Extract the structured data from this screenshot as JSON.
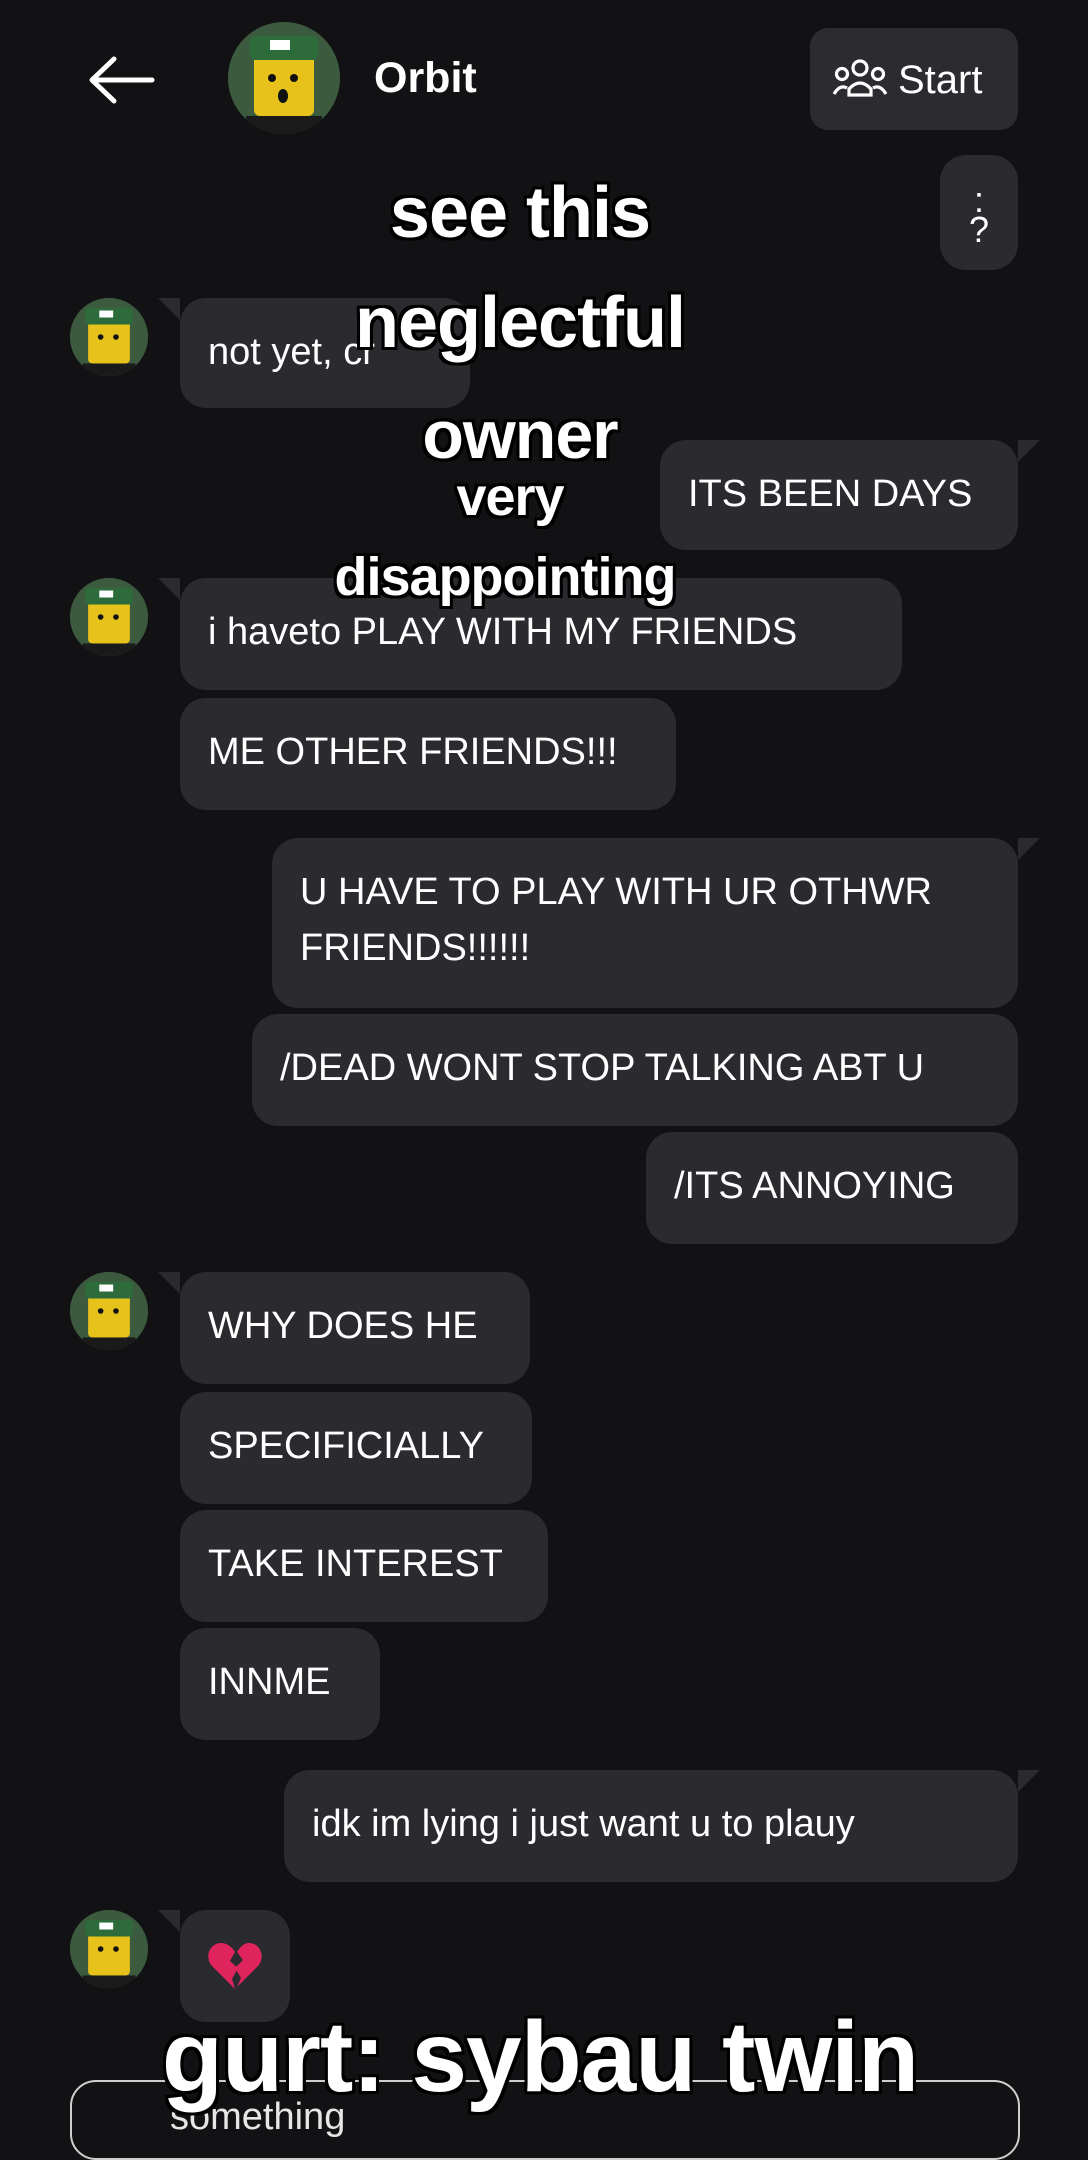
{
  "header": {
    "contact_name": "Orbit",
    "start_label": "Start"
  },
  "messages": [
    {
      "dir": "out",
      "text": ":\n?"
    },
    {
      "dir": "in",
      "text": "not yet, cr"
    },
    {
      "dir": "out",
      "text": "ITS BEEN DAYS"
    },
    {
      "dir": "in",
      "text": "i haveto PLAY WITH MY FRIENDS"
    },
    {
      "dir": "in",
      "text": "ME OTHER FRIENDS!!!"
    },
    {
      "dir": "out",
      "text": "U HAVE TO PLAY WITH UR OTHWR FRIENDS!!!!!!"
    },
    {
      "dir": "out",
      "text": "/DEAD WONT STOP TALKING ABT U"
    },
    {
      "dir": "out",
      "text": "/ITS ANNOYING"
    },
    {
      "dir": "in",
      "text": "WHY DOES HE"
    },
    {
      "dir": "in",
      "text": "SPECIFICIALLY"
    },
    {
      "dir": "in",
      "text": "TAKE INTEREST"
    },
    {
      "dir": "in",
      "text": "INNME"
    },
    {
      "dir": "out",
      "text": "idk im lying i just want u to plauy"
    },
    {
      "dir": "in",
      "emoji": "broken-heart-icon"
    }
  ],
  "overlay_captions": [
    "see this",
    "neglectful",
    "owner",
    "very",
    "disappointing",
    "gurt: sybau twin"
  ],
  "composer": {
    "text": "something"
  },
  "colors": {
    "background": "#121215",
    "bubble": "#2a2a2f",
    "text": "#ffffff",
    "heart": "#e0245e"
  }
}
